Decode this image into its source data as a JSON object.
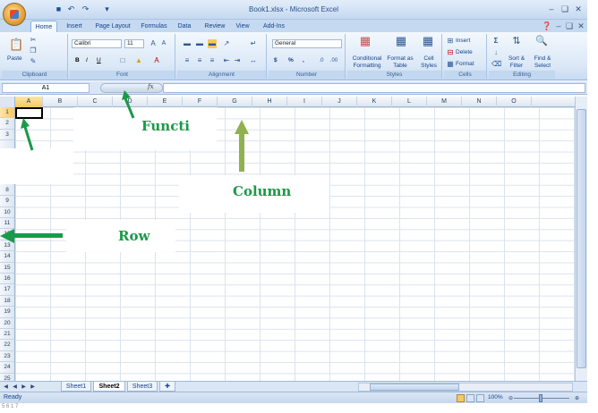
{
  "window": {
    "title": "Book1.xlsx - Microsoft Excel",
    "qat_icons": [
      "save-icon",
      "undo-icon",
      "redo-icon",
      "customize-icon"
    ],
    "controls": [
      "minimize-icon",
      "restore-icon",
      "close-icon"
    ],
    "ribbon_controls": [
      "help-icon",
      "ribbon-minimize-icon",
      "ribbon-restore-icon",
      "ribbon-close-icon"
    ]
  },
  "tabs": [
    "Home",
    "Insert",
    "Page Layout",
    "Formulas",
    "Data",
    "Review",
    "View",
    "Add-Ins"
  ],
  "active_tab": "Home",
  "ribbon": {
    "clipboard": {
      "label": "Clipboard",
      "paste": "Paste"
    },
    "font": {
      "label": "Font",
      "name": "Calibri",
      "size": "11",
      "bold": "B",
      "italic": "I",
      "underline": "U"
    },
    "alignment": {
      "label": "Alignment"
    },
    "number": {
      "label": "Number",
      "format": "General",
      "currency": "$",
      "percent": "%",
      "comma": ","
    },
    "styles": {
      "label": "Styles",
      "conditional": "Conditional Formatting",
      "format_table": "Format as Table",
      "cell_styles": "Cell Styles"
    },
    "cells": {
      "label": "Cells",
      "insert": "Insert",
      "delete": "Delete",
      "format": "Format"
    },
    "editing": {
      "label": "Editing",
      "sort": "Sort & Filter",
      "find": "Find & Select"
    }
  },
  "formula_bar": {
    "name_box": "A1",
    "fx": "fx",
    "value": ""
  },
  "columns": [
    "A",
    "B",
    "C",
    "D",
    "E",
    "F",
    "G",
    "H",
    "I",
    "J",
    "K",
    "L",
    "M",
    "N",
    "O"
  ],
  "selected_column": "A",
  "rows": [
    "1",
    "2",
    "3",
    "8",
    "9",
    "10",
    "11",
    "12",
    "13",
    "14",
    "15",
    "16",
    "17",
    "18",
    "19",
    "20",
    "21",
    "22",
    "23",
    "24",
    "25"
  ],
  "selected_row": "1",
  "sheets": [
    "Sheet1",
    "Sheet2",
    "Sheet3"
  ],
  "active_sheet": "Sheet2",
  "status": {
    "text": "Ready",
    "zoom": "100%"
  },
  "annotations": {
    "function": "Functi",
    "column": "Column",
    "row": "Row"
  },
  "footer": "5 6 1 7"
}
